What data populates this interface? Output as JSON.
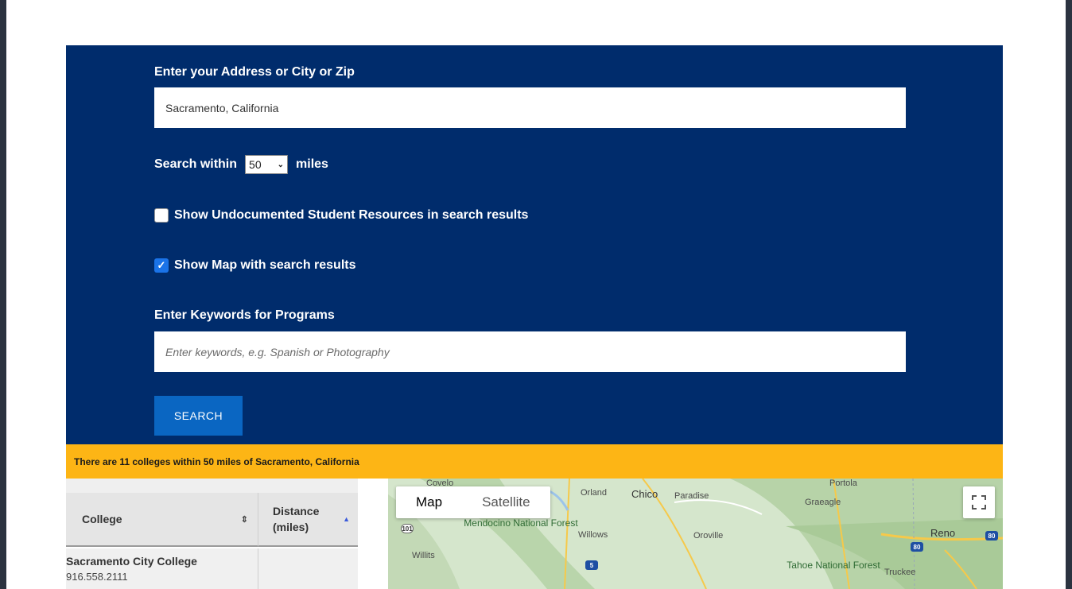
{
  "form": {
    "address_label": "Enter your Address or City or Zip",
    "address_value": "Sacramento, California",
    "search_within_prefix": "Search within",
    "radius_value": "50",
    "search_within_suffix": "miles",
    "undocumented_label": "Show Undocumented Student Resources in search results",
    "undocumented_checked": false,
    "map_label": "Show Map with search results",
    "map_checked": true,
    "keywords_label": "Enter Keywords for Programs",
    "keywords_value": "",
    "keywords_placeholder": "Enter keywords, e.g. Spanish or Photography",
    "search_button": "SEARCH"
  },
  "results": {
    "summary": "There are 11 colleges within 50 miles of Sacramento, California",
    "columns": [
      "College",
      "Distance (miles)"
    ],
    "rows": [
      {
        "college": "Sacramento City College",
        "phone": "916.558.2111",
        "distance": ""
      }
    ]
  },
  "map": {
    "type_options": [
      "Map",
      "Satellite"
    ],
    "active_type": "Map",
    "places": [
      {
        "name": "Covelo"
      },
      {
        "name": "Orland"
      },
      {
        "name": "Chico"
      },
      {
        "name": "Paradise"
      },
      {
        "name": "Portola"
      },
      {
        "name": "Graeagle"
      },
      {
        "name": "Mendocino National Forest"
      },
      {
        "name": "Willows"
      },
      {
        "name": "Oroville"
      },
      {
        "name": "Reno"
      },
      {
        "name": "Willits"
      },
      {
        "name": "Tahoe National Forest"
      },
      {
        "name": "Truckee"
      }
    ],
    "shields": [
      "101",
      "5",
      "80",
      "80"
    ]
  },
  "colors": {
    "panel": "#002c6c",
    "banner": "#fdb515",
    "button": "#0a66c2",
    "checkbox_on": "#1a73e8"
  }
}
